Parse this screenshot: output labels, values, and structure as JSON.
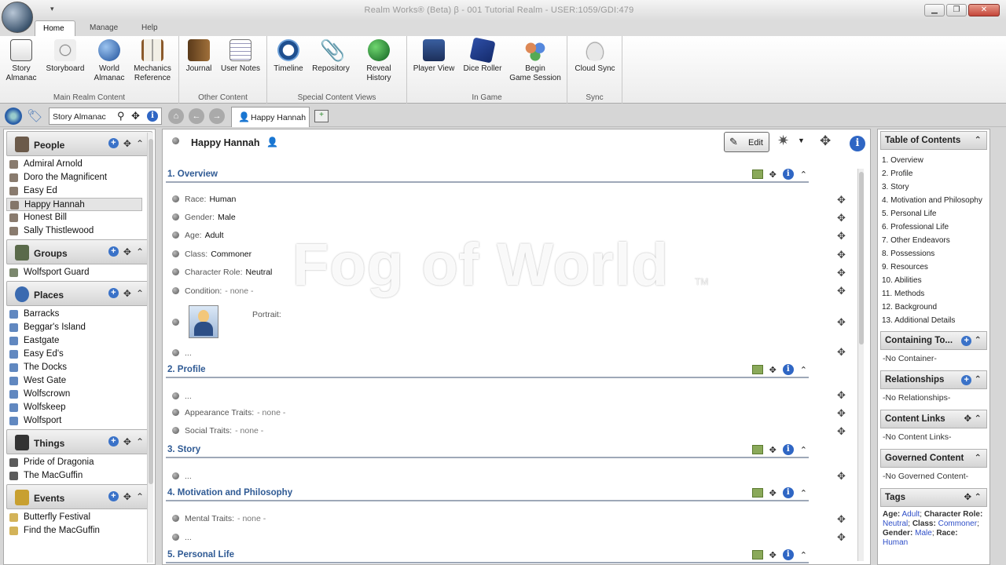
{
  "window": {
    "title": "Realm Works® (Beta) β - 001 Tutorial Realm - USER:1059/GDI:479",
    "qat": "▾"
  },
  "tabs": [
    "Home",
    "Manage",
    "Help"
  ],
  "ribbon": {
    "groups": [
      {
        "label": "Main Realm Content",
        "buttons": [
          "Story\nAlmanac",
          "Storyboard",
          "World\nAlmanac",
          "Mechanics\nReference"
        ]
      },
      {
        "label": "Other Content",
        "buttons": [
          "Journal",
          "User Notes"
        ]
      },
      {
        "label": "Special Content Views",
        "buttons": [
          "Timeline",
          "Repository",
          "Reveal\nHistory"
        ]
      },
      {
        "label": "In Game",
        "buttons": [
          "Player View",
          "Dice Roller",
          "Begin\nGame Session"
        ]
      },
      {
        "label": "Sync",
        "buttons": [
          "Cloud Sync"
        ]
      }
    ]
  },
  "nav": {
    "search_value": "Story Almanac",
    "tab_label": "Happy Hannah"
  },
  "left": {
    "categories": [
      {
        "name": "People",
        "items": [
          "Admiral Arnold",
          "Doro the Magnificent",
          "Easy Ed",
          "Happy Hannah",
          "Honest Bill",
          "Sally Thistlewood"
        ],
        "selected": 3
      },
      {
        "name": "Groups",
        "items": [
          "Wolfsport Guard"
        ]
      },
      {
        "name": "Places",
        "items": [
          "Barracks",
          "Beggar's Island",
          "Eastgate",
          "Easy Ed's",
          "The Docks",
          "West Gate",
          "Wolfscrown",
          "Wolfskeep",
          "Wolfsport"
        ]
      },
      {
        "name": "Things",
        "items": [
          "Pride of Dragonia",
          "The MacGuffin"
        ]
      },
      {
        "name": "Events",
        "items": [
          "Butterfly Festival",
          "Find the MacGuffin"
        ]
      }
    ]
  },
  "main": {
    "title": "Happy Hannah",
    "edit_label": "Edit",
    "sections": [
      {
        "title": "1. Overview",
        "fields": [
          [
            "Race:",
            "Human"
          ],
          [
            "Gender:",
            "Male"
          ],
          [
            "Age:",
            "Adult"
          ],
          [
            "Class:",
            "Commoner"
          ],
          [
            "Character Role:",
            "Neutral"
          ],
          [
            "Condition:",
            "- none -"
          ]
        ],
        "portrait_label": "Portrait:",
        "more": "..."
      },
      {
        "title": "2. Profile",
        "more": "...",
        "fields": [
          [
            "Appearance Traits:",
            "- none -"
          ],
          [
            "Social Traits:",
            "- none -"
          ]
        ]
      },
      {
        "title": "3. Story",
        "more": "..."
      },
      {
        "title": "4. Motivation and Philosophy",
        "fields": [
          [
            "Mental Traits:",
            "- none -"
          ]
        ],
        "more": "..."
      },
      {
        "title": "5. Personal Life"
      }
    ]
  },
  "watermark": {
    "text": "Fog of World",
    "tm": "TM"
  },
  "right": {
    "toc_title": "Table of Contents",
    "toc": [
      "1. Overview",
      "2. Profile",
      "3. Story",
      "4. Motivation and Philosophy",
      "5. Personal Life",
      "6. Professional Life",
      "7. Other Endeavors",
      "8. Possessions",
      "9. Resources",
      "10. Abilities",
      "11. Methods",
      "12. Background",
      "13. Additional Details"
    ],
    "containing_title": "Containing To...",
    "containing_body": "-No Container-",
    "rel_title": "Relationships",
    "rel_body": "-No Relationships-",
    "links_title": "Content Links",
    "links_body": "-No Content Links-",
    "gov_title": "Governed Content",
    "gov_body": "-No Governed Content-",
    "tags_title": "Tags",
    "tags": {
      "age_label": "Age:",
      "age": "Adult",
      "char_label": "Character Role:",
      "char": "Neutral",
      "class_label": "Class:",
      "class": "Commoner",
      "gender_label": "Gender:",
      "gender": "Male",
      "race_label": "Race:",
      "race": "Human"
    }
  },
  "colors": {
    "accent": "#2f5a94",
    "link": "#2f4fc8",
    "info": "#2f66c4"
  }
}
